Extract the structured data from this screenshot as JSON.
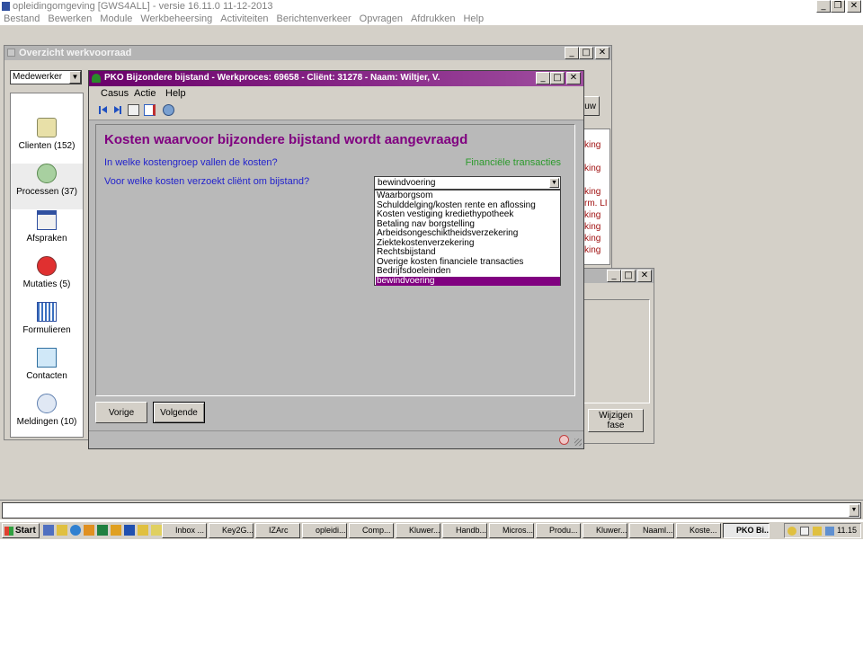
{
  "app": {
    "title": "opleidingomgeving [GWS4ALL] - versie 16.11.0   11-12-2013",
    "menu": [
      "Bestand",
      "Bewerken",
      "Module",
      "Werkbeheersing",
      "Activiteiten",
      "Berichtenverkeer",
      "Opvragen",
      "Afdrukken",
      "Help"
    ]
  },
  "werkvoorraad": {
    "title": "Overzicht werkvoorraad",
    "filter_value": "Medewerker",
    "partial_button": "uw",
    "red_items": [
      "king",
      "king",
      "king",
      "rm. LI",
      "king",
      "king",
      "king",
      "king"
    ],
    "sidebar": [
      {
        "label": "Clienten (152)",
        "icon": "clients-icon"
      },
      {
        "label": "Processen (37)",
        "icon": "processes-icon"
      },
      {
        "label": "Afspraken",
        "icon": "appointments-icon"
      },
      {
        "label": "Mutaties (5)",
        "icon": "mutations-icon"
      },
      {
        "label": "Formulieren",
        "icon": "forms-icon"
      },
      {
        "label": "Contacten",
        "icon": "contacts-icon"
      },
      {
        "label": "Meldingen (10)",
        "icon": "notifications-icon"
      }
    ]
  },
  "back_window": {
    "button": "Wijzigen fase"
  },
  "dialog": {
    "title": "PKO Bijzondere bijstand - Werkproces: 69658 - Cliënt: 31278 - Naam: Wiltjer, V.",
    "menu": [
      "Casus",
      "Actie",
      "Help"
    ],
    "heading": "Kosten waarvoor bijzondere bijstand wordt aangevraagd",
    "question1": "In welke kostengroep vallen de kosten?",
    "answer1": "Financiële transacties",
    "question2": "Voor welke kosten verzoekt cliënt om bijstand?",
    "select_value": "bewindvoering",
    "options": [
      "Waarborgsom",
      "Schulddelging/kosten rente en aflossing",
      "Kosten vestiging krediethypotheek",
      "Betaling nav borgstelling",
      "Arbeidsongeschiktheidsverzekering",
      "Ziektekostenverzekering",
      "Rechtsbijstand",
      "Overige kosten financiele transacties",
      "Bedrijfsdoeleinden",
      "bewindvoering"
    ],
    "selected_index": 9,
    "prev_label": "Vorige",
    "next_label": "Volgende"
  },
  "taskbar": {
    "start": "Start",
    "tasks": [
      "Inbox ...",
      "Key2G...",
      "IZArc",
      "opleidi...",
      "Comp...",
      "Kluwer...",
      "Handb...",
      "Micros...",
      "Produ...",
      "Kluwer...",
      "Naaml...",
      "Koste...",
      "PKO Bi..."
    ],
    "clock": "11.15"
  },
  "colors": {
    "accent_purple": "#800080",
    "question_blue": "#2222cc",
    "answer_green": "#2c9a2c",
    "link_red": "#a01010"
  }
}
